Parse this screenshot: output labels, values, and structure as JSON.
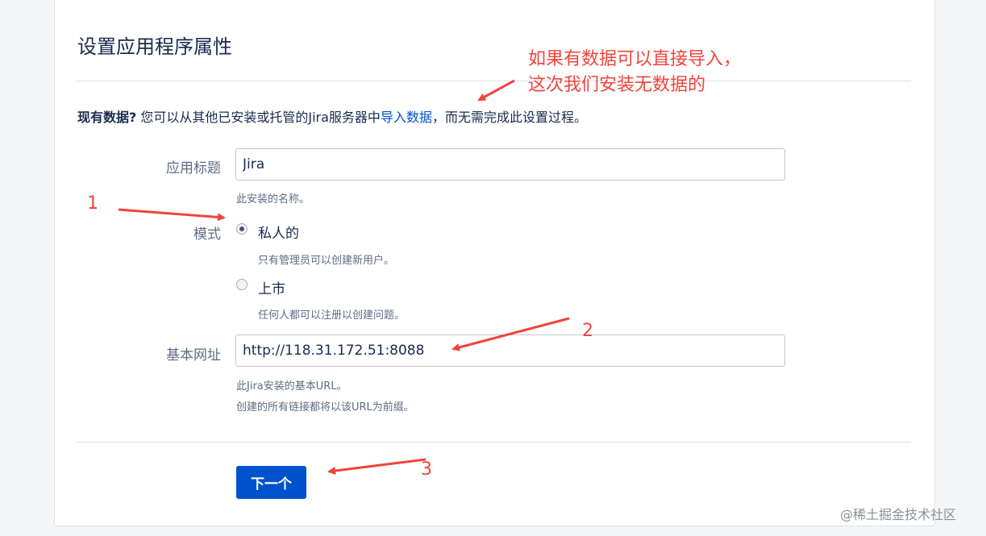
{
  "page": {
    "title": "设置应用程序属性",
    "intro": {
      "bold": "现有数据?",
      "before_link": " 您可以从其他已安装或托管的Jira服务器中",
      "link": "导入数据",
      "after_link": "，而无需完成此设置过程。"
    }
  },
  "form": {
    "app_title": {
      "label": "应用标题",
      "value": "Jira",
      "help": "此安装的名称。"
    },
    "mode": {
      "label": "模式",
      "options": [
        {
          "label": "私人的",
          "help": "只有管理员可以创建新用户。",
          "checked": true
        },
        {
          "label": "上市",
          "help": "任何人都可以注册以创建问题。",
          "checked": false
        }
      ]
    },
    "base_url": {
      "label": "基本网址",
      "value": "http://118.31.172.51:8088",
      "help_lines": [
        "此Jira安装的基本URL。",
        "创建的所有链接都将以该URL为前缀。"
      ]
    },
    "next_button": "下一个"
  },
  "annotations": {
    "note_lines": [
      "如果有数据可以直接导入，",
      "这次我们安装无数据的"
    ],
    "numbers": [
      "1",
      "2",
      "3"
    ],
    "color": "#f0443c"
  },
  "watermark": "@稀土掘金技术社区",
  "colors": {
    "accent": "#0052cc",
    "text": "#172b4d",
    "muted": "#5e6c84"
  }
}
